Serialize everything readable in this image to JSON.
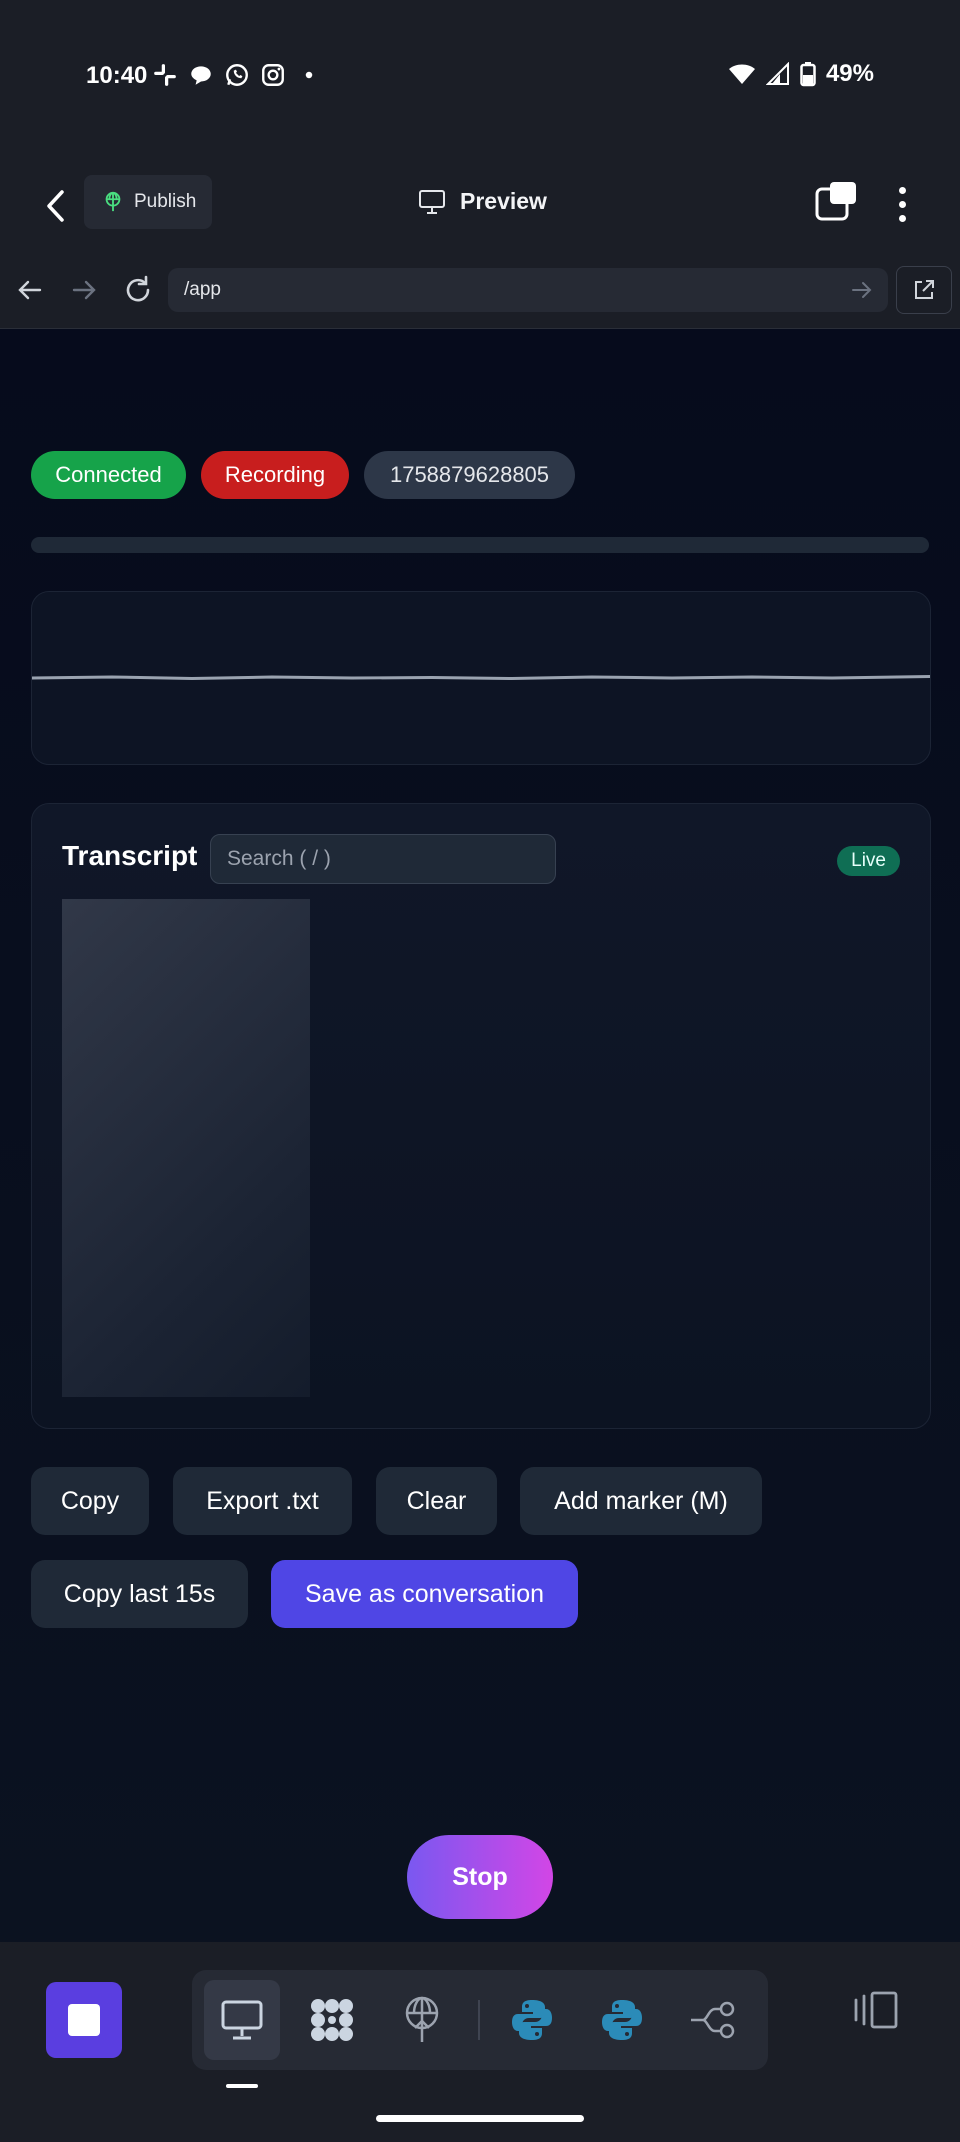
{
  "status_bar": {
    "time": "10:40",
    "notification_icons": [
      "slack-icon",
      "chat-bubble-icon",
      "whatsapp-icon",
      "instagram-icon",
      "dot-icon"
    ],
    "battery_text": "49%"
  },
  "header": {
    "publish_label": "Publish",
    "preview_label": "Preview"
  },
  "browser": {
    "url": "/app"
  },
  "badges": {
    "connected": "Connected",
    "recording": "Recording",
    "session_id": "1758879628805"
  },
  "transcript": {
    "title": "Transcript",
    "search_placeholder": "Search ( / )",
    "live_label": "Live"
  },
  "actions": {
    "copy": "Copy",
    "export": "Export .txt",
    "clear": "Clear",
    "add_marker": "Add marker (M)",
    "copy_last": "Copy last 15s",
    "save": "Save as conversation"
  },
  "stop_label": "Stop",
  "colors": {
    "connected": "#16a34a",
    "recording": "#dc2626",
    "primary": "#4f46e5",
    "live": "#0f6e54"
  }
}
